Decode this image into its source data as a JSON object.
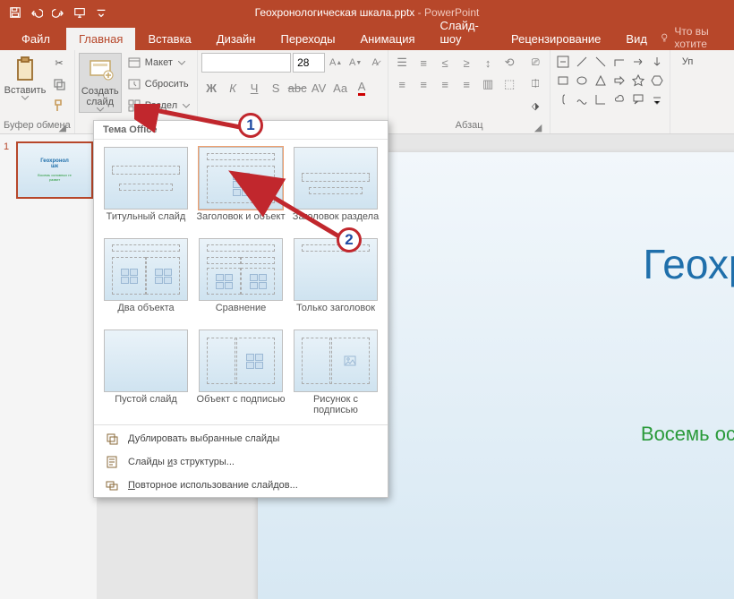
{
  "title": {
    "doc": "Геохронологическая шкала.pptx",
    "app": "PowerPoint"
  },
  "tabs": {
    "file": "Файл",
    "home": "Главная",
    "insert": "Вставка",
    "design": "Дизайн",
    "transitions": "Переходы",
    "animations": "Анимация",
    "slideshow": "Слайд-шоу",
    "review": "Рецензирование",
    "view": "Вид",
    "tellme": "Что вы хотите"
  },
  "groups": {
    "clipboard": "Буфер обмена",
    "paragraph": "Абзац",
    "edit_label": "Уп"
  },
  "clipboard": {
    "paste": "Вставить"
  },
  "slides": {
    "new": "Создать слайд",
    "layout": "Макет",
    "reset": "Сбросить",
    "section": "Раздел"
  },
  "font": {
    "name": "",
    "size": "28"
  },
  "thumbnail": {
    "num": "1",
    "title": "Геохронол\nшк",
    "sub": "Восемь основных ге\nразвит"
  },
  "slide": {
    "title": "Геохроноло\nшкал",
    "subtitle": "Восемь основных геолог\nразвития Зе"
  },
  "menu": {
    "header": "Тема Office",
    "layouts": [
      "Титульный слайд",
      "Заголовок и объект",
      "Заголовок раздела",
      "Два объекта",
      "Сравнение",
      "Только заголовок",
      "Пустой слайд",
      "Объект с подписью",
      "Рисунок с подписью"
    ],
    "dup": "Дублировать выбранные слайды",
    "outline": "Слайды из структуры...",
    "reuse": "Повторное использование слайдов...",
    "outline_u": "и",
    "reuse_u": "П"
  },
  "annot": {
    "n1": "1",
    "n2": "2"
  }
}
